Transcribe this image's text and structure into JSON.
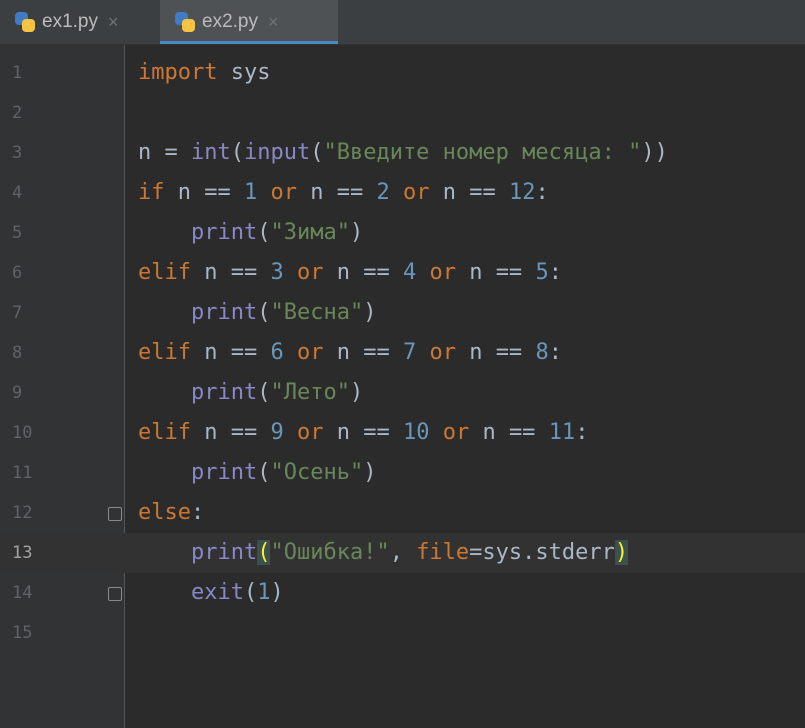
{
  "tabs": [
    {
      "label": "ex1.py",
      "active": false,
      "icon": "python-file-icon"
    },
    {
      "label": "ex2.py",
      "active": true,
      "icon": "python-file-icon"
    }
  ],
  "close_glyph": "×",
  "colors": {
    "keyword": "#cc7832",
    "number": "#6897bb",
    "string": "#6a8759",
    "builtin": "#8888c6",
    "text": "#a9b7c6",
    "background": "#2b2b2b",
    "tab_active_underline": "#4a88c7"
  },
  "current_line": 13,
  "lines": [
    {
      "n": "1",
      "code": "import sys"
    },
    {
      "n": "2",
      "code": ""
    },
    {
      "n": "3",
      "code": "n = int(input(\"Введите номер месяца: \"))"
    },
    {
      "n": "4",
      "code": "if n == 1 or n == 2 or n == 12:"
    },
    {
      "n": "5",
      "code": "    print(\"Зима\")"
    },
    {
      "n": "6",
      "code": "elif n == 3 or n == 4 or n == 5:"
    },
    {
      "n": "7",
      "code": "    print(\"Весна\")"
    },
    {
      "n": "8",
      "code": "elif n == 6 or n == 7 or n == 8:"
    },
    {
      "n": "9",
      "code": "    print(\"Лето\")"
    },
    {
      "n": "10",
      "code": "elif n == 9 or n == 10 or n == 11:"
    },
    {
      "n": "11",
      "code": "    print(\"Осень\")"
    },
    {
      "n": "12",
      "code": "else:"
    },
    {
      "n": "13",
      "code": "    print(\"Ошибка!\", file=sys.stderr)"
    },
    {
      "n": "14",
      "code": "    exit(1)"
    },
    {
      "n": "15",
      "code": ""
    }
  ]
}
